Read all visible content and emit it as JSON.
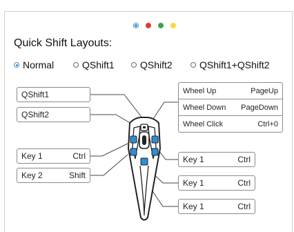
{
  "page_dots": [
    {
      "color": "#3a8fd9",
      "selected": true
    },
    {
      "color": "#e53935",
      "selected": false
    },
    {
      "color": "#43a047",
      "selected": false
    },
    {
      "color": "#fdd835",
      "selected": false
    }
  ],
  "title": "Quick Shift Layouts:",
  "layouts": [
    {
      "label": "Normal",
      "checked": true
    },
    {
      "label": "QShift1",
      "checked": false
    },
    {
      "label": "QShift2",
      "checked": false
    },
    {
      "label": "QShift1+QShift2",
      "checked": false
    }
  ],
  "left_buttons": {
    "qshift1": "QShift1",
    "qshift2": "QShift2",
    "key1": {
      "name": "Key 1",
      "action": "Ctrl"
    },
    "key2": {
      "name": "Key 2",
      "action": "Shift"
    }
  },
  "wheel": [
    {
      "name": "Wheel Up",
      "action": "PageUp"
    },
    {
      "name": "Wheel Down",
      "action": "PageDown"
    },
    {
      "name": "Wheel Click",
      "action": "Ctrl+0"
    }
  ],
  "right_buttons": [
    {
      "name": "Key 1",
      "action": "Ctrl"
    },
    {
      "name": "Key 1",
      "action": "Ctrl"
    },
    {
      "name": "Key 1",
      "action": "Ctrl"
    }
  ],
  "colors": {
    "accent": "#3a8fd9",
    "device_button": "#2b8fd6"
  }
}
